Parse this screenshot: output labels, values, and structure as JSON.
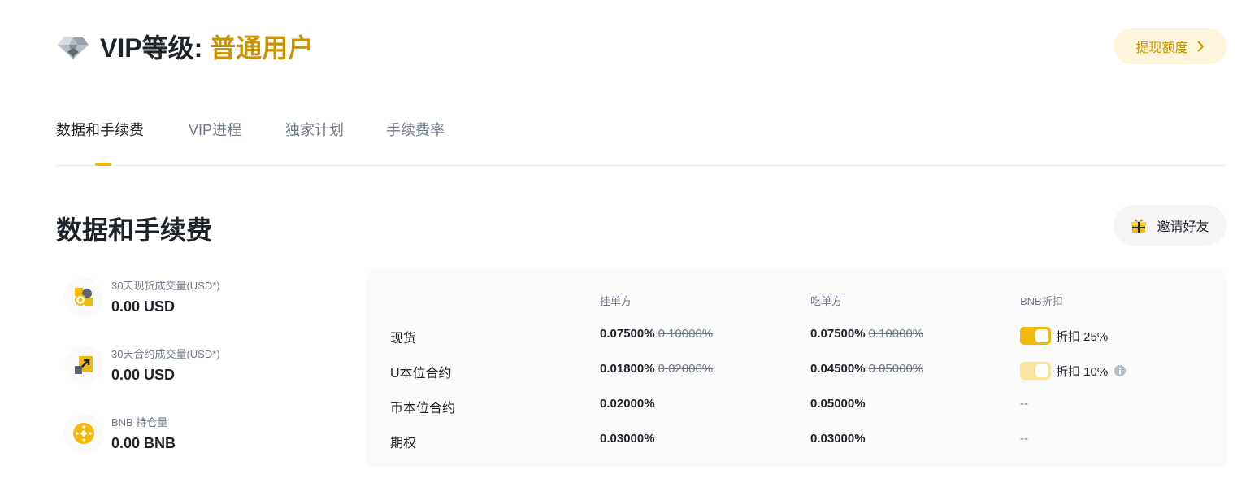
{
  "header": {
    "title_prefix": "VIP等级: ",
    "title_level": "普通用户",
    "withdraw_label": "提现额度"
  },
  "tabs": [
    {
      "label": "数据和手续费",
      "active": true
    },
    {
      "label": "VIP进程",
      "active": false
    },
    {
      "label": "独家计划",
      "active": false
    },
    {
      "label": "手续费率",
      "active": false
    }
  ],
  "section": {
    "title": "数据和手续费",
    "invite_label": "邀请好友"
  },
  "stats": [
    {
      "label": "30天现货成交量(USD*)",
      "value": "0.00 USD",
      "icon": "spot-volume-icon"
    },
    {
      "label": "30天合约成交量(USD*)",
      "value": "0.00 USD",
      "icon": "futures-volume-icon"
    },
    {
      "label": "BNB 持仓量",
      "value": "0.00 BNB",
      "icon": "bnb-icon"
    }
  ],
  "fees": {
    "headers": {
      "maker": "挂单方",
      "taker": "吃单方",
      "bnb": "BNB折扣"
    },
    "rows": [
      {
        "name": "现货",
        "maker": "0.07500%",
        "maker_old": "0.10000%",
        "taker": "0.07500%",
        "taker_old": "0.10000%",
        "bnb": "折扣 25%"
      },
      {
        "name": "U本位合约",
        "maker": "0.01800%",
        "maker_old": "0.02000%",
        "taker": "0.04500%",
        "taker_old": "0.05000%",
        "bnb": "折扣 10%"
      },
      {
        "name": "币本位合约",
        "maker": "0.02000%",
        "taker": "0.05000%",
        "bnb": "--"
      },
      {
        "name": "期权",
        "maker": "0.03000%",
        "taker": "0.03000%",
        "bnb": "--"
      }
    ]
  },
  "colors": {
    "accent": "#f0b90b",
    "accent_text": "#c99400",
    "text": "#1e2329",
    "muted": "#707a8a"
  }
}
